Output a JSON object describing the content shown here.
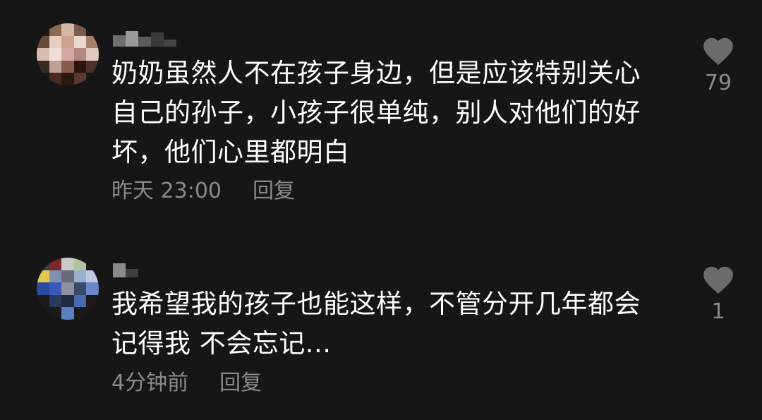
{
  "comments": [
    {
      "text_lines": [
        "奶奶虽然人不在孩子身边，但是应该特别关心",
        "自己的孙子，小孩子很单纯，别人对他们的好",
        "坏，他们心里都明白"
      ],
      "time": "昨天 23:00",
      "reply_label": "回复",
      "likes": "79",
      "icons": {
        "like": "heart-icon"
      },
      "avatar_colors": [
        "#1a1a1a",
        "#8a6a50",
        "#d6b6a4",
        "#7a5a48",
        "#1a1a1a",
        "#6a4a3a",
        "#e6cfc2",
        "#cba28f",
        "#e9d8cf",
        "#a6806c",
        "#d7beae",
        "#efdfd7",
        "#d4a8a0",
        "#b48a7e",
        "#e2c9bd",
        "#3a2a24",
        "#bda092",
        "#8a5a4c",
        "#2a1410",
        "#4a3028",
        "#1a1a1a",
        "#4a2a20",
        "#2a1812",
        "#5a3a30",
        "#1a1a1a"
      ]
    },
    {
      "text_lines": [
        "我希望我的孩子也能这样，不管分开几年都会",
        "记得我 不会忘记..."
      ],
      "time": "4分钟前",
      "reply_label": "回复",
      "likes": "1",
      "icons": {
        "like": "heart-icon"
      },
      "avatar_colors": [
        "#3a3a52",
        "#7a2a2a",
        "#c9c9c9",
        "#b0c4a0",
        "#1a1a1a",
        "#e0c850",
        "#8090b0",
        "#6a6a7a",
        "#9ab0d0",
        "#c0c8e0",
        "#2a4aa0",
        "#3a58b8",
        "#9090a0",
        "#3a4a6a",
        "#6a88c8",
        "#1a1a1a",
        "#2a3a5a",
        "#202a40",
        "#4a6ab0",
        "#1a1a1a",
        "#1a1a1a",
        "#1a1a1a",
        "#5a80c0",
        "#1a1a1a",
        "#1a1a1a"
      ]
    }
  ]
}
